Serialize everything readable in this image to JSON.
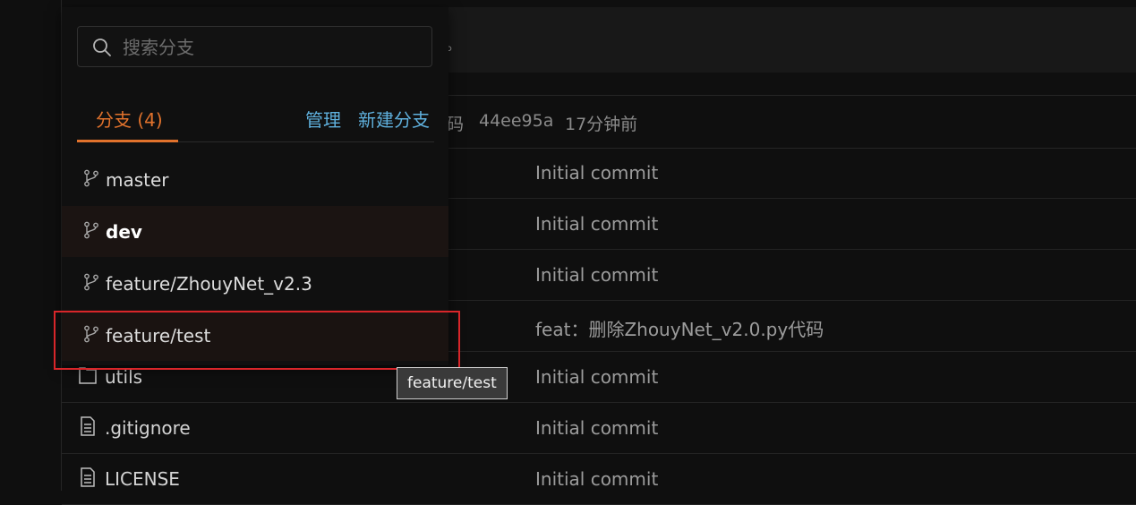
{
  "notice": {
    "text": "。"
  },
  "latest_commit": {
    "message_fragment": "码",
    "hash": "44ee95a",
    "time": "17分钟前"
  },
  "files": [
    {
      "name": "",
      "type": "folder-icon",
      "message": "Initial commit"
    },
    {
      "name": "",
      "type": "folder-icon",
      "message": "Initial commit"
    },
    {
      "name": "",
      "type": "folder-icon",
      "message": "Initial commit"
    },
    {
      "name": "",
      "type": "folder-icon",
      "message": "feat：删除ZhouyNet_v2.0.py代码"
    },
    {
      "name": "utils",
      "type": "folder-icon",
      "message": "Initial commit"
    },
    {
      "name": ".gitignore",
      "type": "file-icon",
      "message": "Initial commit"
    },
    {
      "name": "LICENSE",
      "type": "file-icon",
      "message": "Initial commit"
    }
  ],
  "branch_dropdown": {
    "search": {
      "placeholder": "搜索分支",
      "value": ""
    },
    "tab_label": "分支 (4)",
    "manage_label": "管理",
    "new_branch_label": "新建分支",
    "branches": [
      {
        "name": "master"
      },
      {
        "name": "dev"
      },
      {
        "name": "feature/ZhouyNet_v2.3"
      },
      {
        "name": "feature/test"
      }
    ],
    "current_branch": "dev",
    "tooltip": "feature/test"
  },
  "colors": {
    "accent_orange": "#e1722c",
    "link_blue": "#5fb0dd",
    "highlight_red": "#d8262a",
    "background": "#0f0f0f"
  }
}
